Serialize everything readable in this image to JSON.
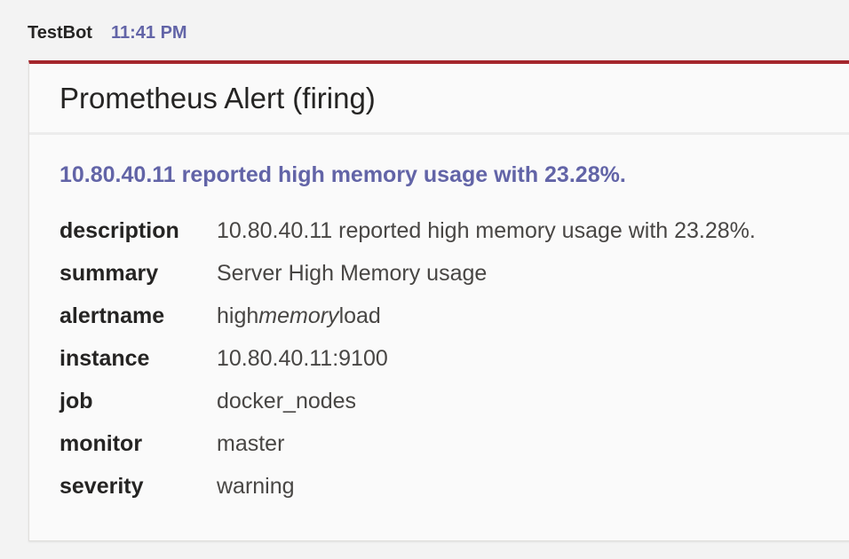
{
  "message": {
    "sender": "TestBot",
    "timestamp": "11:41 PM"
  },
  "card": {
    "title": "Prometheus Alert (firing)",
    "summary": "10.80.40.11 reported high memory usage with 23.28%.",
    "facts": [
      {
        "key": "description",
        "value": "10.80.40.11 reported high memory usage with 23.28%."
      },
      {
        "key": "summary",
        "value": "Server High Memory usage"
      },
      {
        "key": "alertname",
        "value_prefix": "high",
        "value_italic": "memory",
        "value_suffix": "load"
      },
      {
        "key": "instance",
        "value": "10.80.40.11:9100"
      },
      {
        "key": "job",
        "value": "docker_nodes"
      },
      {
        "key": "monitor",
        "value": "master"
      },
      {
        "key": "severity",
        "value": "warning"
      }
    ],
    "accent_color": "#a4262c",
    "link_color": "#6264a7"
  }
}
